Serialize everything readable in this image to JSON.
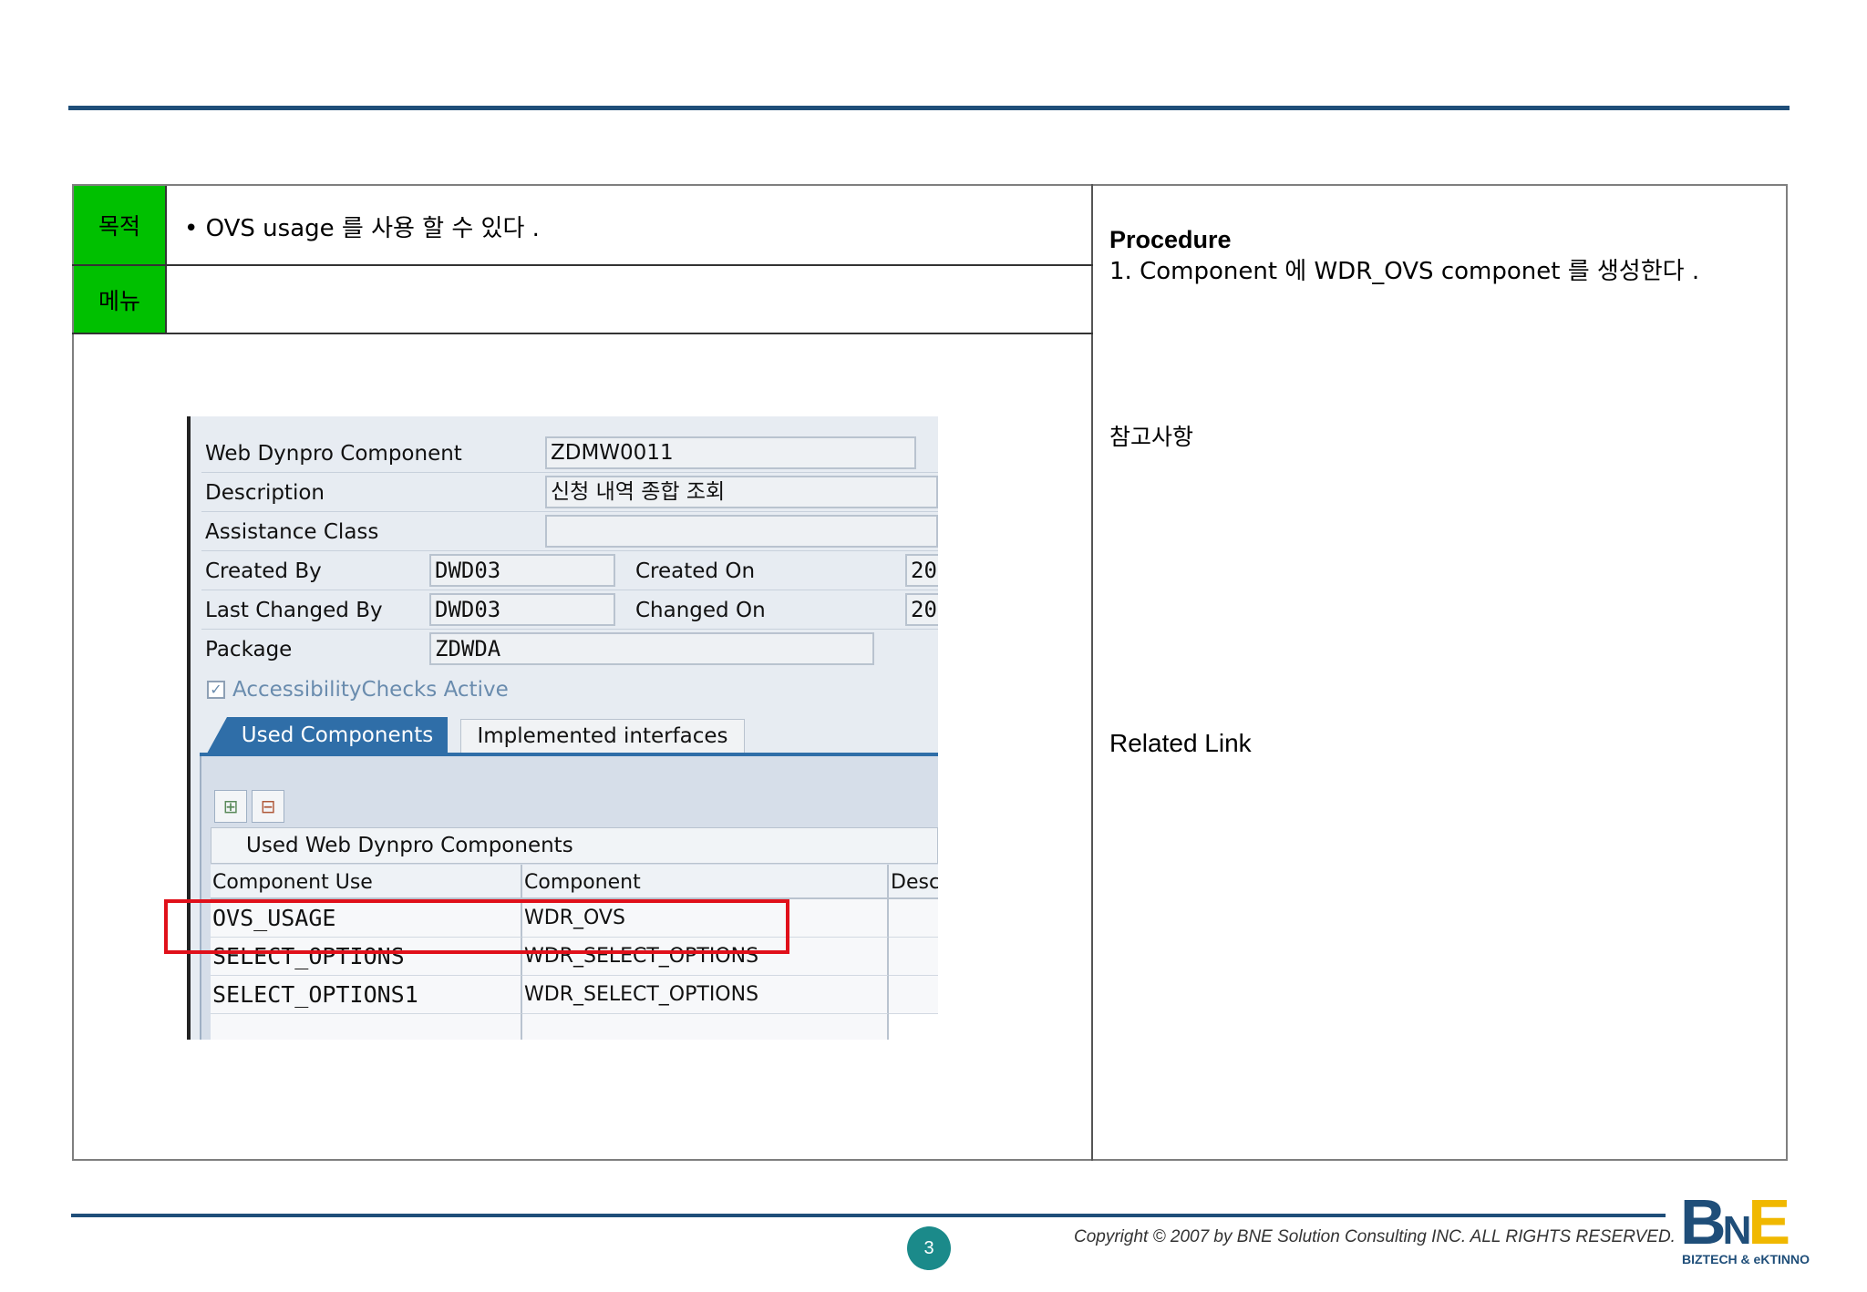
{
  "header": {},
  "left_table": {
    "objective_label": "목적",
    "objective_text": "• OVS usage 를 사용 할 수 있다 .",
    "menu_label": "메뉴",
    "menu_text": ""
  },
  "sap_screen": {
    "fields": {
      "component_label": "Web Dynpro Component",
      "component_value": "ZDMW0011",
      "description_label": "Description",
      "description_value": "신청 내역 종합 조회",
      "assistance_label": "Assistance Class",
      "assistance_value": "",
      "created_by_label": "Created By",
      "created_by_value": "DWD03",
      "created_on_label": "Created On",
      "created_on_value": "20",
      "changed_by_label": "Last Changed By",
      "changed_by_value": "DWD03",
      "changed_on_label": "Changed On",
      "changed_on_value": "20",
      "package_label": "Package",
      "package_value": "ZDWDA",
      "accessibility_label": "AccessibilityChecks Active"
    },
    "tabs": {
      "used_components": "Used Components",
      "implemented_interfaces": "Implemented interfaces"
    },
    "table": {
      "title": "Used Web Dynpro Components",
      "headers": [
        "Component Use",
        "Component",
        "Desc"
      ],
      "rows": [
        [
          "OVS_USAGE",
          "WDR_OVS",
          ""
        ],
        [
          "SELECT_OPTIONS",
          "WDR_SELECT_OPTIONS",
          ""
        ],
        [
          "SELECT_OPTIONS1",
          "WDR_SELECT_OPTIONS",
          ""
        ]
      ]
    },
    "icons": [
      "insert-row-icon",
      "delete-row-icon"
    ]
  },
  "right_panel": {
    "procedure_title": "Procedure",
    "procedure_step": "1. Component 에  WDR_OVS componet 를 생성한다 .",
    "note_title": "참고사항",
    "related_link": "Related Link"
  },
  "footer": {
    "page_number": "3",
    "copyright": "Copyright © 2007 by BNE Solution Consulting INC.   ALL RIGHTS RESERVED.",
    "logo_text": "BNE",
    "logo_sub": "BIZTECH & eKTINNO"
  },
  "colors": {
    "accent_blue": "#1f4e79",
    "label_green": "#00c000",
    "highlight_red": "#e0101a",
    "page_badge": "#1b8a8a"
  }
}
